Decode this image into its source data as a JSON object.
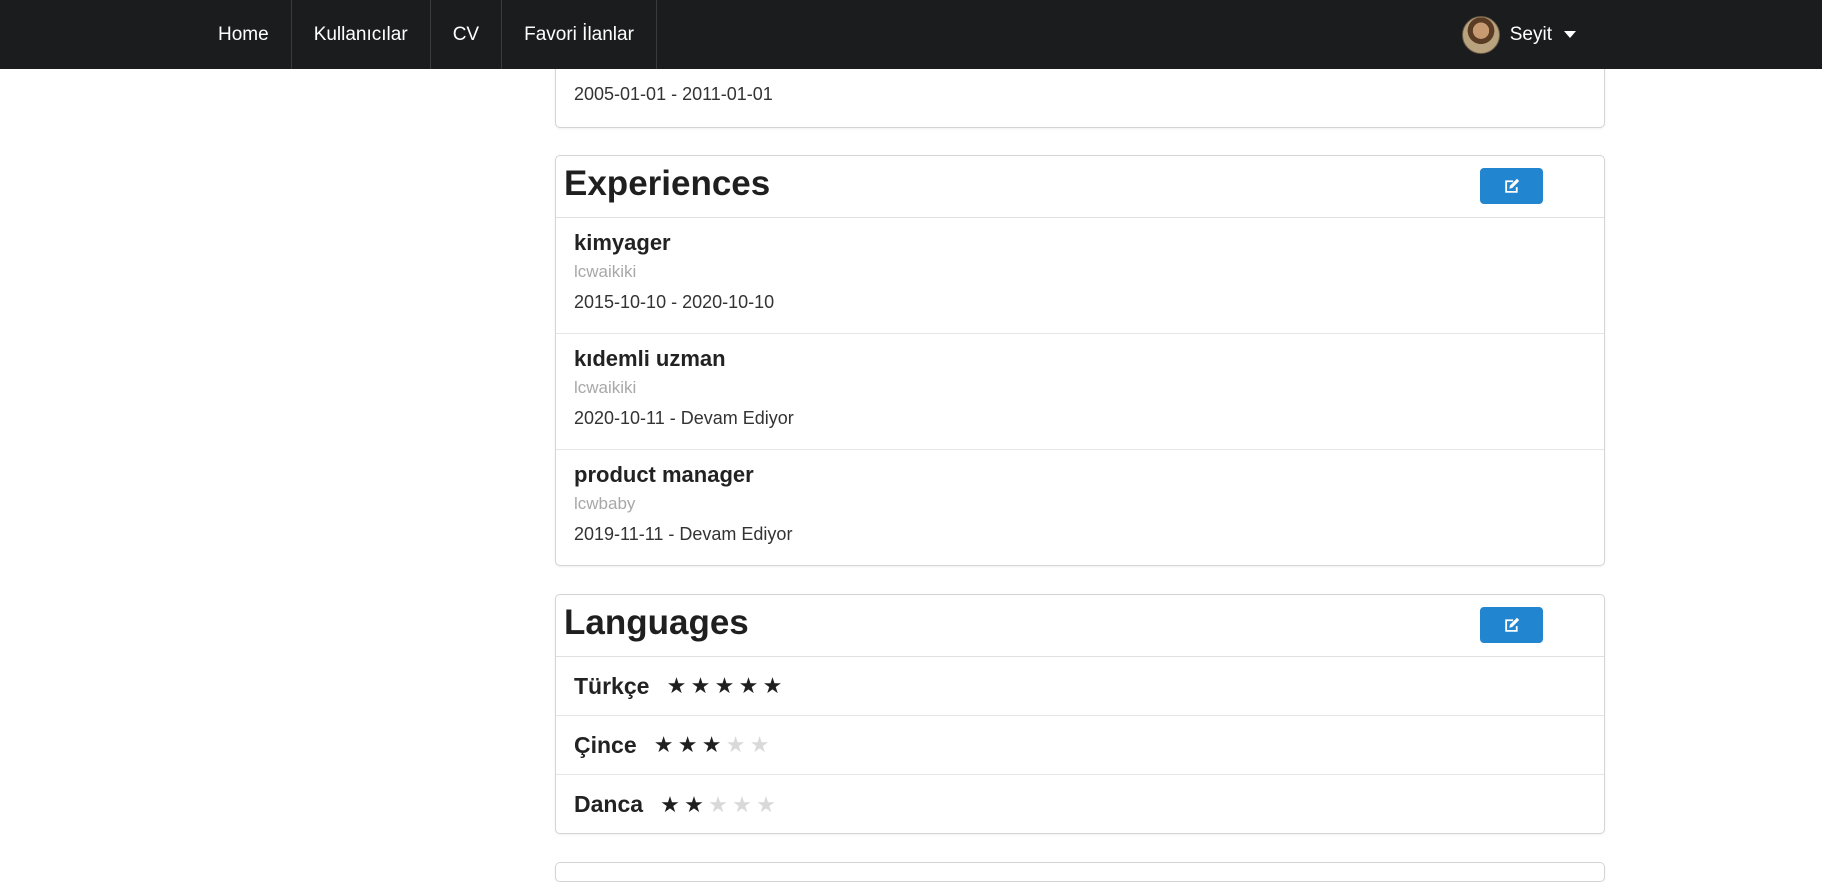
{
  "nav": {
    "items": [
      {
        "label": "Home"
      },
      {
        "label": "Kullanıcılar"
      },
      {
        "label": "CV"
      },
      {
        "label": "Favori İlanlar"
      }
    ],
    "user": {
      "name": "Seyit"
    }
  },
  "education_tail": {
    "dates": "2005-01-01 - 2011-01-01"
  },
  "experiences": {
    "title": "Experiences",
    "items": [
      {
        "position": "kimyager",
        "company": "lcwaikiki",
        "dates": "2015-10-10 - 2020-10-10"
      },
      {
        "position": "kıdemli uzman",
        "company": "lcwaikiki",
        "dates": "2020-10-11 - Devam Ediyor"
      },
      {
        "position": "product manager",
        "company": "lcwbaby",
        "dates": "2019-11-11 - Devam Ediyor"
      }
    ]
  },
  "languages": {
    "title": "Languages",
    "items": [
      {
        "name": "Türkçe",
        "level": 5,
        "max": 5
      },
      {
        "name": "Çince",
        "level": 3,
        "max": 5
      },
      {
        "name": "Danca",
        "level": 2,
        "max": 5
      }
    ]
  },
  "icons": {
    "edit": "edit-icon",
    "caret": "caret-down-icon",
    "star": "star-icon"
  },
  "colors": {
    "navbar": "#1b1c1d",
    "edit_button": "#2185d0",
    "star_on": "#1f1f1f",
    "star_off": "#d9d9d9"
  }
}
